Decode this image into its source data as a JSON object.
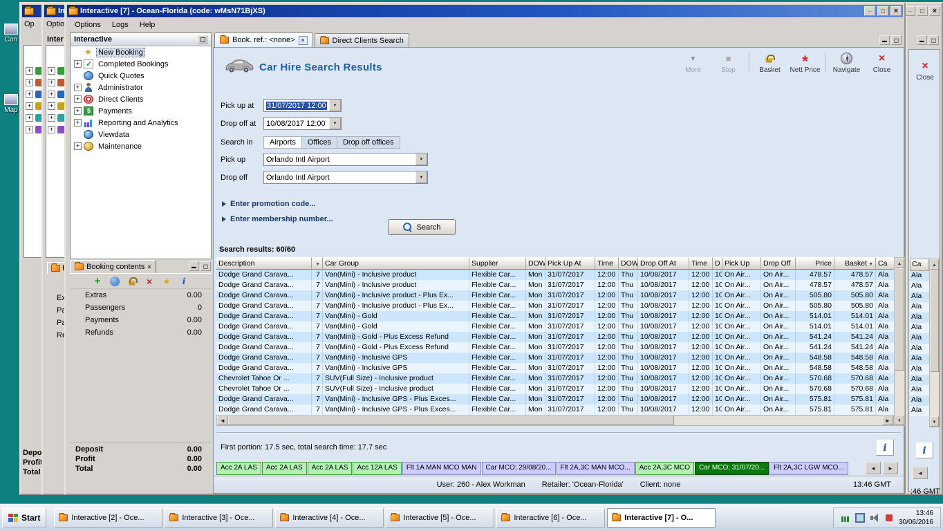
{
  "desktop": {
    "icons": [
      "Con",
      "Map"
    ]
  },
  "bg_left": {
    "w5_menu": "Op",
    "w5_totals": [
      "Depo",
      "Profit",
      "Total"
    ],
    "w6_title": "Int",
    "w6_menu": "Options",
    "w6_tree_header": "Inter",
    "w6_tab": "Bo",
    "w6_rows": [
      "Ex",
      "Pa",
      "Pa",
      "Re"
    ]
  },
  "right_win": {
    "close_label": "Close",
    "col_header": "Ca",
    "cells": [
      "Ala",
      "Ala",
      "Ala",
      "Ala",
      "Ala",
      "Ala",
      "Ala",
      "Ala",
      "Ala",
      "Ala",
      "Ala",
      "Ala",
      "Ala",
      "Ala"
    ],
    "time": ":46 GMT"
  },
  "window": {
    "title": "Interactive [7] - Ocean-Florida (code: wMsN71BjXS)",
    "menu": [
      "Options",
      "Logs",
      "Help"
    ],
    "tree": {
      "header": "Interactive",
      "items": [
        {
          "label": "New Booking",
          "icon": "new-booking-icon",
          "selected": true,
          "expand": false
        },
        {
          "label": "Completed Bookings",
          "icon": "completed-bookings-icon",
          "selected": false,
          "expand": true
        },
        {
          "label": "Quick Quotes",
          "icon": "quick-quotes-icon",
          "selected": false,
          "expand": false
        },
        {
          "label": "Administrator",
          "icon": "administrator-icon",
          "selected": false,
          "expand": true
        },
        {
          "label": "Direct Clients",
          "icon": "direct-clients-icon",
          "selected": false,
          "expand": true
        },
        {
          "label": "Payments",
          "icon": "payments-icon",
          "selected": false,
          "expand": true
        },
        {
          "label": "Reporting and Analytics",
          "icon": "reporting-icon",
          "selected": false,
          "expand": true
        },
        {
          "label": "Viewdata",
          "icon": "viewdata-icon",
          "selected": false,
          "expand": false
        },
        {
          "label": "Maintenance",
          "icon": "maintenance-icon",
          "selected": false,
          "expand": true
        }
      ]
    },
    "booking": {
      "tab": "Booking contents",
      "toolbar_icons": [
        "add-icon",
        "refresh-icon",
        "basket-icon",
        "delete-icon",
        "star-icon",
        "info-icon"
      ],
      "rows": [
        {
          "label": "Extras",
          "value": "0.00"
        },
        {
          "label": "Passengers",
          "value": "0"
        },
        {
          "label": "Payments",
          "value": "0.00"
        },
        {
          "label": "Refunds",
          "value": "0.00"
        }
      ],
      "totals": [
        {
          "label": "Deposit",
          "value": "0.00"
        },
        {
          "label": "Profit",
          "value": "0.00"
        },
        {
          "label": "Total",
          "value": "0.00"
        }
      ]
    },
    "doc_tabs": [
      {
        "label": "Book. ref.: <none>",
        "active": true,
        "closable": true
      },
      {
        "label": "Direct Clients Search",
        "active": false,
        "closable": false
      }
    ],
    "search": {
      "title": "Car Hire Search Results",
      "toolbar": [
        {
          "label": "More",
          "icon": "more-icon",
          "disabled": true
        },
        {
          "label": "Stop",
          "icon": "stop-icon",
          "disabled": true
        },
        {
          "label": "Basket",
          "icon": "basket-icon",
          "disabled": false
        },
        {
          "label": "Nett Price",
          "icon": "nett-price-icon",
          "disabled": false
        },
        {
          "label": "Navigate",
          "icon": "navigate-icon",
          "disabled": false
        },
        {
          "label": "Close",
          "icon": "close-icon",
          "disabled": false
        }
      ],
      "pickup_at": {
        "label": "Pick up at",
        "value": "31/07/2017 12:00"
      },
      "dropoff_at": {
        "label": "Drop off at",
        "value": "10/08/2017 12:00"
      },
      "search_in": {
        "label": "Search in",
        "options": [
          "Airports",
          "Offices",
          "Drop off offices"
        ],
        "selected": "Airports"
      },
      "pickup": {
        "label": "Pick up",
        "value": "Orlando Intl Airport"
      },
      "dropoff": {
        "label": "Drop off",
        "value": "Orlando Intl Airport"
      },
      "promo_link": "Enter promotion code...",
      "membership_link": "Enter membership number...",
      "search_button": "Search",
      "results_label": "Search results: 60/60"
    },
    "results": {
      "columns": [
        "Description",
        "",
        "Car Group",
        "Supplier",
        "DOW",
        "Pick Up At",
        "Time",
        "DOW",
        "Drop Off At",
        "Time",
        "D",
        "Pick Up",
        "Drop Off",
        "Price",
        "Basket",
        "Ca"
      ],
      "rows": [
        [
          "Dodge Grand Carava...",
          "7",
          "Van(Mini) - Inclusive product",
          "Flexible Car...",
          "Mon",
          "31/07/2017",
          "12:00",
          "Thu",
          "10/08/2017",
          "12:00",
          "10",
          "On Air...",
          "On Air...",
          "478.57",
          "478.57",
          "Ala"
        ],
        [
          "Dodge Grand Carava...",
          "7",
          "Van(Mini) - Inclusive product",
          "Flexible Car...",
          "Mon",
          "31/07/2017",
          "12:00",
          "Thu",
          "10/08/2017",
          "12:00",
          "10",
          "On Air...",
          "On Air...",
          "478.57",
          "478.57",
          "Ala"
        ],
        [
          "Dodge Grand Carava...",
          "7",
          "Van(Mini) - Inclusive product - Plus Ex...",
          "Flexible Car...",
          "Mon",
          "31/07/2017",
          "12:00",
          "Thu",
          "10/08/2017",
          "12:00",
          "10",
          "On Air...",
          "On Air...",
          "505.80",
          "505.80",
          "Ala"
        ],
        [
          "Dodge Grand Carava...",
          "7",
          "Van(Mini) - Inclusive product - Plus Ex...",
          "Flexible Car...",
          "Mon",
          "31/07/2017",
          "12:00",
          "Thu",
          "10/08/2017",
          "12:00",
          "10",
          "On Air...",
          "On Air...",
          "505.80",
          "505.80",
          "Ala"
        ],
        [
          "Dodge Grand Carava...",
          "7",
          "Van(Mini) - Gold",
          "Flexible Car...",
          "Mon",
          "31/07/2017",
          "12:00",
          "Thu",
          "10/08/2017",
          "12:00",
          "10",
          "On Air...",
          "On Air...",
          "514.01",
          "514.01",
          "Ala"
        ],
        [
          "Dodge Grand Carava...",
          "7",
          "Van(Mini) - Gold",
          "Flexible Car...",
          "Mon",
          "31/07/2017",
          "12:00",
          "Thu",
          "10/08/2017",
          "12:00",
          "10",
          "On Air...",
          "On Air...",
          "514.01",
          "514.01",
          "Ala"
        ],
        [
          "Dodge Grand Carava...",
          "7",
          "Van(Mini) - Gold - Plus Excess Refund",
          "Flexible Car...",
          "Mon",
          "31/07/2017",
          "12:00",
          "Thu",
          "10/08/2017",
          "12:00",
          "10",
          "On Air...",
          "On Air...",
          "541.24",
          "541.24",
          "Ala"
        ],
        [
          "Dodge Grand Carava...",
          "7",
          "Van(Mini) - Gold - Plus Excess Refund",
          "Flexible Car...",
          "Mon",
          "31/07/2017",
          "12:00",
          "Thu",
          "10/08/2017",
          "12:00",
          "10",
          "On Air...",
          "On Air...",
          "541.24",
          "541.24",
          "Ala"
        ],
        [
          "Dodge Grand Carava...",
          "7",
          "Van(Mini) - Inclusive GPS",
          "Flexible Car...",
          "Mon",
          "31/07/2017",
          "12:00",
          "Thu",
          "10/08/2017",
          "12:00",
          "10",
          "On Air...",
          "On Air...",
          "548.58",
          "548.58",
          "Ala"
        ],
        [
          "Dodge Grand Carava...",
          "7",
          "Van(Mini) - Inclusive GPS",
          "Flexible Car...",
          "Mon",
          "31/07/2017",
          "12:00",
          "Thu",
          "10/08/2017",
          "12:00",
          "10",
          "On Air...",
          "On Air...",
          "548.58",
          "548.58",
          "Ala"
        ],
        [
          "Chevrolet Tahoe Or ...",
          "7",
          "SUV(Full Size) - Inclusive product",
          "Flexible Car...",
          "Mon",
          "31/07/2017",
          "12:00",
          "Thu",
          "10/08/2017",
          "12:00",
          "10",
          "On Air...",
          "On Air...",
          "570.68",
          "570.68",
          "Ala"
        ],
        [
          "Chevrolet Tahoe Or ...",
          "7",
          "SUV(Full Size) - Inclusive product",
          "Flexible Car...",
          "Mon",
          "31/07/2017",
          "12:00",
          "Thu",
          "10/08/2017",
          "12:00",
          "10",
          "On Air...",
          "On Air...",
          "570.68",
          "570.68",
          "Ala"
        ],
        [
          "Dodge Grand Carava...",
          "7",
          "Van(Mini) - Inclusive GPS - Plus Exces...",
          "Flexible Car...",
          "Mon",
          "31/07/2017",
          "12:00",
          "Thu",
          "10/08/2017",
          "12:00",
          "10",
          "On Air...",
          "On Air...",
          "575.81",
          "575.81",
          "Ala"
        ],
        [
          "Dodge Grand Carava...",
          "7",
          "Van(Mini) - Inclusive GPS - Plus Exces...",
          "Flexible Car...",
          "Mon",
          "31/07/2017",
          "12:00",
          "Thu",
          "10/08/2017",
          "12:00",
          "10",
          "On Air...",
          "On Air...",
          "575.81",
          "575.81",
          "Ala"
        ]
      ]
    },
    "status_line": "First portion: 17.5 sec, total search time: 17.7 sec",
    "session_tabs": [
      {
        "label": "Acc 2A LAS",
        "type": "green"
      },
      {
        "label": "Acc 2A LAS",
        "type": "green"
      },
      {
        "label": "Acc 2A LAS",
        "type": "green"
      },
      {
        "label": "Acc 12A LAS",
        "type": "green"
      },
      {
        "label": "Flt 1A MAN MCO MAN",
        "type": "lavender"
      },
      {
        "label": "Car MCO; 29/08/20...",
        "type": "lavender"
      },
      {
        "label": "Flt 2A,3C MAN MCO...",
        "type": "lavender"
      },
      {
        "label": "Acc 2A,3C MCO",
        "type": "green"
      },
      {
        "label": "Car MCO; 31/07/20...",
        "type": "active"
      },
      {
        "label": "Flt 2A,3C LGW MCO...",
        "type": "lavender"
      }
    ],
    "status_bar": {
      "user": "User: 260 - Alex Workman",
      "retailer": "Retailer: 'Ocean-Florida'",
      "client": "Client: none",
      "time": "13:46 GMT"
    }
  },
  "taskbar": {
    "start": "Start",
    "buttons": [
      {
        "label": "Interactive [2] - Oce...",
        "active": false
      },
      {
        "label": "Interactive [3] - Oce...",
        "active": false
      },
      {
        "label": "Interactive [4] - Oce...",
        "active": false
      },
      {
        "label": "Interactive [5] - Oce...",
        "active": false
      },
      {
        "label": "Interactive [6] - Oce...",
        "active": false
      },
      {
        "label": "Interactive [7] - O...",
        "active": true
      }
    ],
    "tray_icons": [
      "chart-icon",
      "display-icon",
      "volume-icon",
      "connection-icon"
    ],
    "clock_time": "13:46",
    "clock_date": "30/06/2016"
  }
}
